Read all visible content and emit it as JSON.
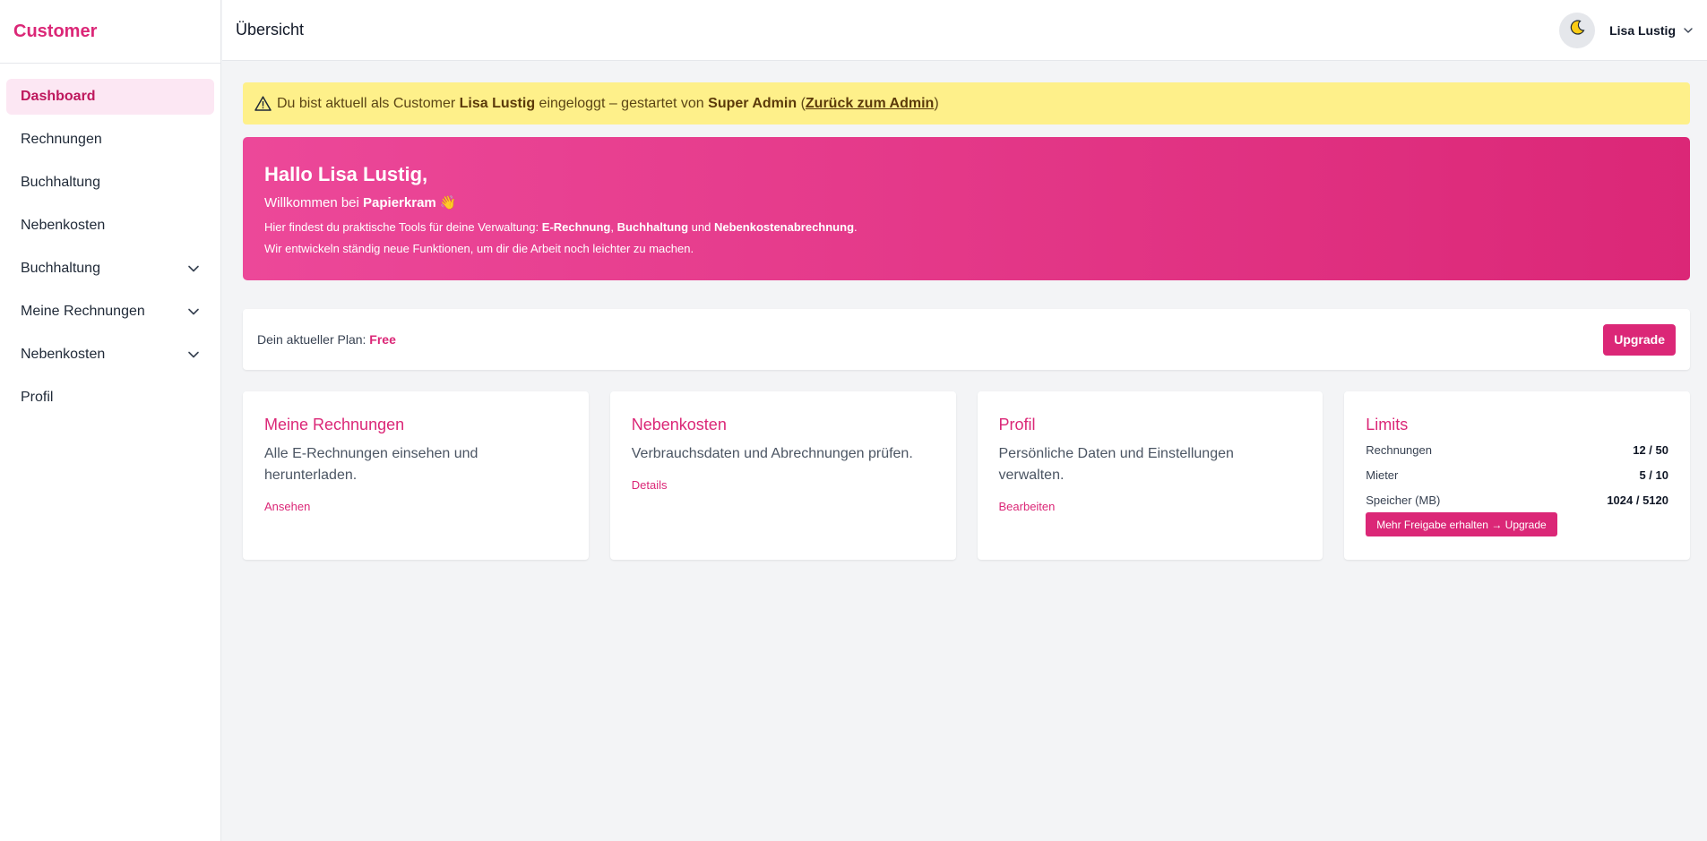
{
  "sidebar": {
    "brand": "Customer",
    "items": [
      {
        "label": "Dashboard"
      },
      {
        "label": "Rechnungen"
      },
      {
        "label": "Buchhaltung"
      },
      {
        "label": "Nebenkosten"
      },
      {
        "label": "Buchhaltung"
      },
      {
        "label": "Meine Rechnungen"
      },
      {
        "label": "Nebenkosten"
      },
      {
        "label": "Profil"
      }
    ]
  },
  "header": {
    "title": "Übersicht",
    "user_name": "Lisa Lustig",
    "theme_icon": "moon-icon"
  },
  "alert": {
    "prefix": "Du bist aktuell als Customer",
    "user": "Lisa Lustig",
    "middle": "eingeloggt – gestartet von",
    "admin": "Super Admin",
    "open_paren": "(",
    "back_link": "Zurück zum Admin",
    "close_paren": ")"
  },
  "hero": {
    "title": "Hallo Lisa Lustig,",
    "welcome_prefix": "Willkommen bei",
    "brand": "Papierkram",
    "wave": "👋",
    "line1_prefix": "Hier findest du praktische Tools für deine Verwaltung:",
    "tool1": "E-Rechnung",
    "sep1": ",",
    "tool2": "Buchhaltung",
    "sep2": "und",
    "tool3": "Nebenkostenabrechnung",
    "dot": ".",
    "line2": "Wir entwickeln ständig neue Funktionen, um dir die Arbeit noch leichter zu machen."
  },
  "plan": {
    "label": "Dein aktueller Plan:",
    "name": "Free",
    "upgrade": "Upgrade"
  },
  "cards": [
    {
      "title": "Meine Rechnungen",
      "desc": "Alle E-Rechnungen einsehen und herunterladen.",
      "link": "Ansehen"
    },
    {
      "title": "Nebenkosten",
      "desc": "Verbrauchsdaten und Abrechnungen prüfen.",
      "link": "Details"
    },
    {
      "title": "Profil",
      "desc": "Persönliche Daten und Einstellungen verwalten.",
      "link": "Bearbeiten"
    }
  ],
  "limits": {
    "title": "Limits",
    "rows": [
      {
        "label": "Rechnungen",
        "value": "12 / 50"
      },
      {
        "label": "Mieter",
        "value": "5 / 10"
      },
      {
        "label": "Speicher (MB)",
        "value": "1024 / 5120"
      }
    ],
    "button": "Mehr Freigabe erhalten → Upgrade"
  },
  "colors": {
    "accent": "#db2777",
    "accent_light": "#fce7f3",
    "alert_bg": "#fef08a",
    "hero_start": "#ec4899",
    "hero_end": "#db2777"
  }
}
